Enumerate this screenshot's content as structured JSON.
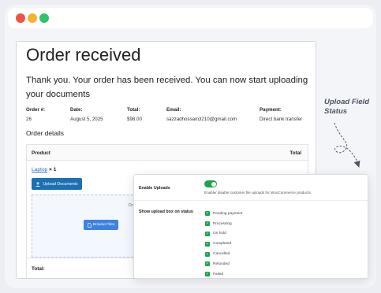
{
  "order": {
    "title": "Order received",
    "message": "Thank you. Your order has been received. You can now start uploading your documents",
    "meta": [
      {
        "label": "Order #:",
        "value": "26"
      },
      {
        "label": "Date:",
        "value": "August 5, 2025"
      },
      {
        "label": "Total:",
        "value": "$98.00"
      },
      {
        "label": "Email:",
        "value": "sazzadhossain3210@gmail.com"
      },
      {
        "label": "Payment:",
        "value": "Direct bank transfer"
      }
    ],
    "details_heading": "Order details",
    "table": {
      "product_header": "Product",
      "total_header": "Total",
      "total_row_label": "Total:"
    },
    "item": {
      "name": "Laptop",
      "qty": "× 1"
    },
    "upload_button": "Upload Documents",
    "dropzone": {
      "line1": "Drag and drop files here",
      "line2": "OR",
      "browse_button": "Browse Files"
    }
  },
  "settings": {
    "enable_label": "Enable Uploads",
    "enable_desc": "Enable/ disable customer file uploads for WooCommerce products.",
    "enable_on": true,
    "colon": ":",
    "status_label": "Show upload box on status",
    "statuses": [
      {
        "label": "Pending payment",
        "checked": true
      },
      {
        "label": "Processing",
        "checked": true
      },
      {
        "label": "On hold",
        "checked": true
      },
      {
        "label": "Completed",
        "checked": true
      },
      {
        "label": "Cancelled",
        "checked": true
      },
      {
        "label": "Refunded",
        "checked": true
      },
      {
        "label": "Failed",
        "checked": true
      }
    ]
  },
  "annotation": {
    "line1": "Upload Field",
    "line2": "Status"
  },
  "colors": {
    "accent_blue": "#1b6fb2",
    "toggle_green": "#1ba34d",
    "dot_red": "#ec5546",
    "dot_yellow": "#f2b331",
    "dot_green": "#2fc36a"
  }
}
